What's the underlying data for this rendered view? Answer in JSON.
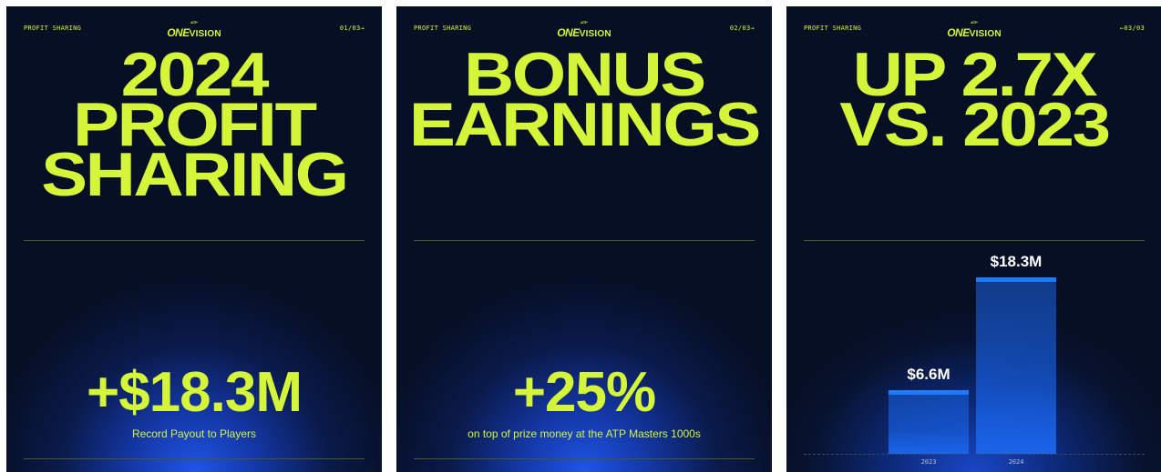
{
  "brand": {
    "small": "ATP",
    "one": "ONE",
    "vision": "VISION"
  },
  "slides": [
    {
      "section": "PROFIT SHARING",
      "page": "01/03→",
      "headline": [
        "2024",
        "PROFIT",
        "SHARING"
      ],
      "stat": "+$18.3M",
      "caption": "Record Payout to Players"
    },
    {
      "section": "PROFIT SHARING",
      "page": "02/03→",
      "headline": [
        "BONUS",
        "EARNINGS"
      ],
      "stat": "+25%",
      "caption": "on top of prize money at the ATP Masters 1000s"
    },
    {
      "section": "PROFIT SHARING",
      "page": "←03/03",
      "headline": [
        "UP 2.7X",
        "VS. 2023"
      ]
    }
  ],
  "chart_data": {
    "type": "bar",
    "categories": [
      "2023",
      "2024"
    ],
    "values": [
      6.6,
      18.3
    ],
    "value_labels": [
      "$6.6M",
      "$18.3M"
    ],
    "colors": {
      "bar": "#1b63e8",
      "cap": "#1e7bff"
    }
  },
  "colors": {
    "accent": "#d4f53a",
    "background": "#070f24"
  }
}
